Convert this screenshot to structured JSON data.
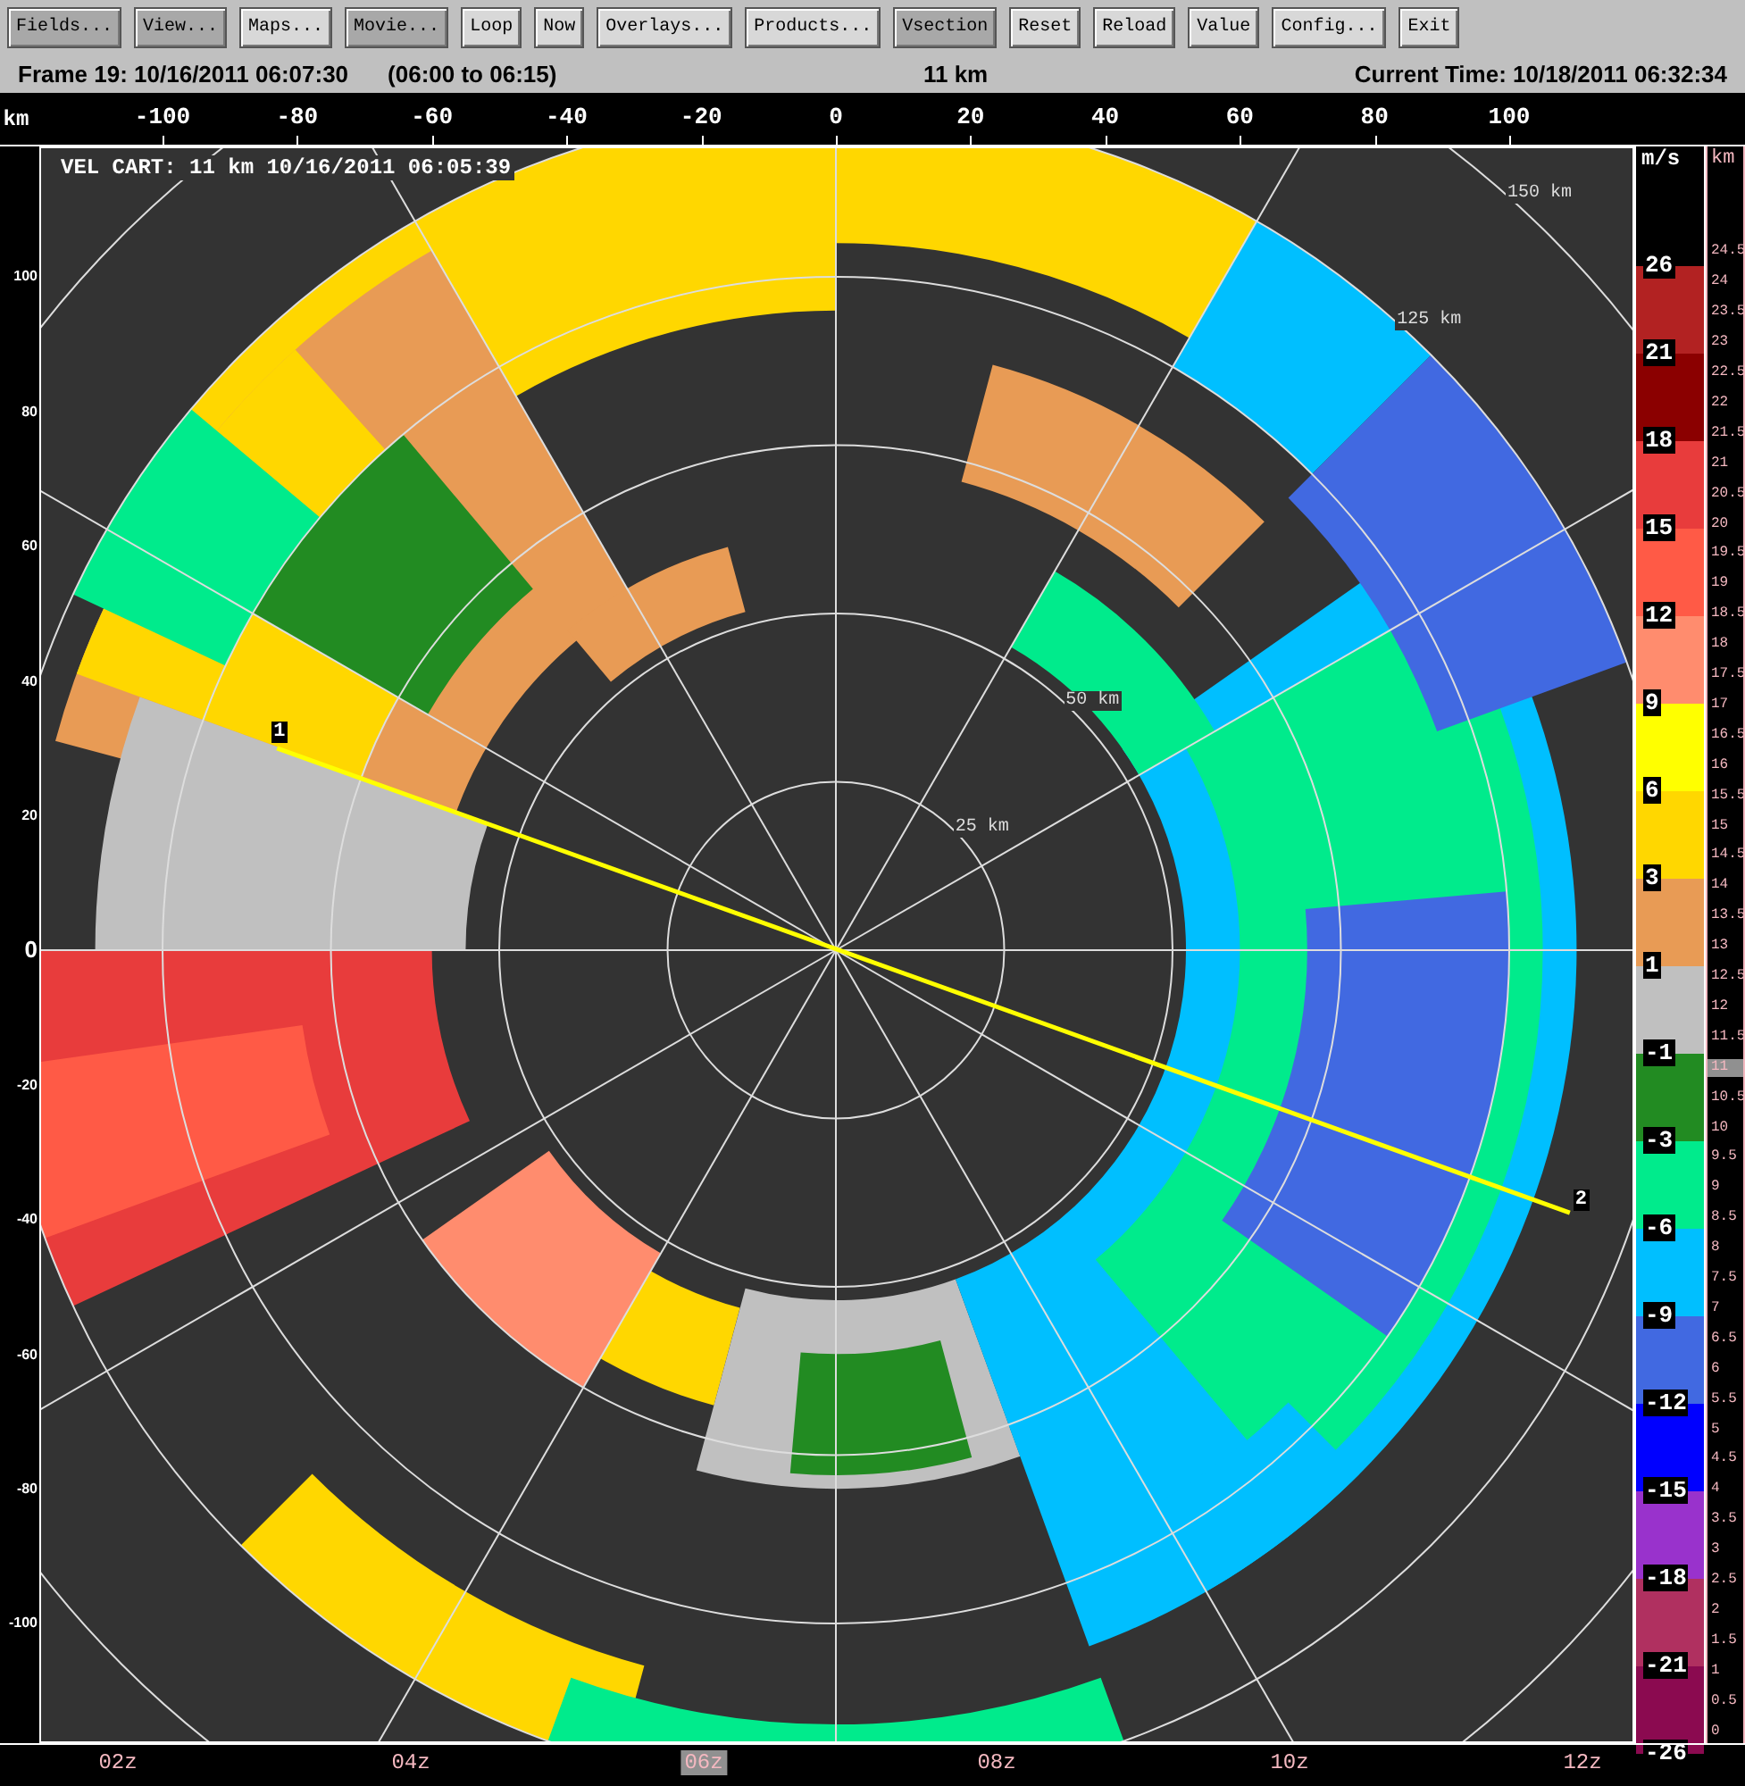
{
  "toolbar": [
    {
      "label": "Fields...",
      "selected": true
    },
    {
      "label": "View...",
      "selected": true
    },
    {
      "label": "Maps...",
      "selected": false
    },
    {
      "label": "Movie...",
      "selected": true
    },
    {
      "label": "Loop",
      "selected": false
    },
    {
      "label": "Now",
      "selected": false
    },
    {
      "label": "Overlays...",
      "selected": false
    },
    {
      "label": "Products...",
      "selected": false
    },
    {
      "label": "Vsection",
      "selected": true
    },
    {
      "label": "Reset",
      "selected": false
    },
    {
      "label": "Reload",
      "selected": false
    },
    {
      "label": "Value",
      "selected": false
    },
    {
      "label": "Config...",
      "selected": false
    },
    {
      "label": "Exit",
      "selected": false
    }
  ],
  "status": {
    "frame": "Frame 19: 10/16/2011 06:07:30",
    "range": "(06:00 to 06:15)",
    "height": "11 km",
    "current_time": "Current Time: 10/18/2011 06:32:34"
  },
  "x_axis": {
    "unit": "km",
    "ticks": [
      "-100",
      "-80",
      "-60",
      "-40",
      "-20",
      "0",
      "20",
      "40",
      "60",
      "80",
      "100"
    ]
  },
  "y_axis": {
    "ticks": [
      "100",
      "80",
      "60",
      "40",
      "20",
      "0",
      "-20",
      "-40",
      "-60",
      "-80",
      "-100"
    ]
  },
  "plot": {
    "title": "VEL CART: 11 km 10/16/2011 06:05:39",
    "range_labels": [
      "25 km",
      "50 km",
      "125 km",
      "150 km"
    ],
    "vsection_markers": [
      "1",
      "2"
    ]
  },
  "colorbar": {
    "unit": "m/s",
    "bins": [
      {
        "label": "26",
        "color": "#b22222"
      },
      {
        "label": "21",
        "color": "#8b0000"
      },
      {
        "label": "18",
        "color": "#e83c3c"
      },
      {
        "label": "15",
        "color": "#ff5a46"
      },
      {
        "label": "12",
        "color": "#ff8c6e"
      },
      {
        "label": "9",
        "color": "#ffff00"
      },
      {
        "label": "6",
        "color": "#ffd700"
      },
      {
        "label": "3",
        "color": "#e89b55"
      },
      {
        "label": "1",
        "color": "#c0c0c0"
      },
      {
        "label": "-1",
        "color": "#228b22"
      },
      {
        "label": "-3",
        "color": "#00eb8c"
      },
      {
        "label": "-6",
        "color": "#00bfff"
      },
      {
        "label": "-9",
        "color": "#4169e1"
      },
      {
        "label": "-12",
        "color": "#0000ff"
      },
      {
        "label": "-15",
        "color": "#9932cc"
      },
      {
        "label": "-18",
        "color": "#b03060"
      },
      {
        "label": "-21",
        "color": "#8b0a50"
      }
    ],
    "end_label": "-26"
  },
  "height_scale": {
    "unit": "km",
    "ticks": [
      {
        "label": "24.5",
        "selected": false
      },
      {
        "label": "24",
        "selected": false
      },
      {
        "label": "23.5",
        "selected": false
      },
      {
        "label": "23",
        "selected": false
      },
      {
        "label": "22.5",
        "selected": false
      },
      {
        "label": "22",
        "selected": false
      },
      {
        "label": "21.5",
        "selected": false
      },
      {
        "label": "21",
        "selected": false
      },
      {
        "label": "20.5",
        "selected": false
      },
      {
        "label": "20",
        "selected": false
      },
      {
        "label": "19.5",
        "selected": false
      },
      {
        "label": "19",
        "selected": false
      },
      {
        "label": "18.5",
        "selected": false
      },
      {
        "label": "18",
        "selected": false
      },
      {
        "label": "17.5",
        "selected": false
      },
      {
        "label": "17",
        "selected": false
      },
      {
        "label": "16.5",
        "selected": false
      },
      {
        "label": "16",
        "selected": false
      },
      {
        "label": "15.5",
        "selected": false
      },
      {
        "label": "15",
        "selected": false
      },
      {
        "label": "14.5",
        "selected": false
      },
      {
        "label": "14",
        "selected": false
      },
      {
        "label": "13.5",
        "selected": false
      },
      {
        "label": "13",
        "selected": false
      },
      {
        "label": "12.5",
        "selected": false
      },
      {
        "label": "12",
        "selected": false
      },
      {
        "label": "11.5",
        "selected": false
      },
      {
        "label": "11",
        "selected": true
      },
      {
        "label": "10.5",
        "selected": false
      },
      {
        "label": "10",
        "selected": false
      },
      {
        "label": "9.5",
        "selected": false
      },
      {
        "label": "9",
        "selected": false
      },
      {
        "label": "8.5",
        "selected": false
      },
      {
        "label": "8",
        "selected": false
      },
      {
        "label": "7.5",
        "selected": false
      },
      {
        "label": "7",
        "selected": false
      },
      {
        "label": "6.5",
        "selected": false
      },
      {
        "label": "6",
        "selected": false
      },
      {
        "label": "5.5",
        "selected": false
      },
      {
        "label": "5",
        "selected": false
      },
      {
        "label": "4.5",
        "selected": false
      },
      {
        "label": "4",
        "selected": false
      },
      {
        "label": "3.5",
        "selected": false
      },
      {
        "label": "3",
        "selected": false
      },
      {
        "label": "2.5",
        "selected": false
      },
      {
        "label": "2",
        "selected": false
      },
      {
        "label": "1.5",
        "selected": false
      },
      {
        "label": "1",
        "selected": false
      },
      {
        "label": "0.5",
        "selected": false
      },
      {
        "label": "0",
        "selected": false
      }
    ]
  },
  "time_axis": [
    {
      "label": "02z",
      "selected": false
    },
    {
      "label": "04z",
      "selected": false
    },
    {
      "label": "06z",
      "selected": true
    },
    {
      "label": "08z",
      "selected": false
    },
    {
      "label": "10z",
      "selected": false
    },
    {
      "label": "12z",
      "selected": false
    }
  ]
}
